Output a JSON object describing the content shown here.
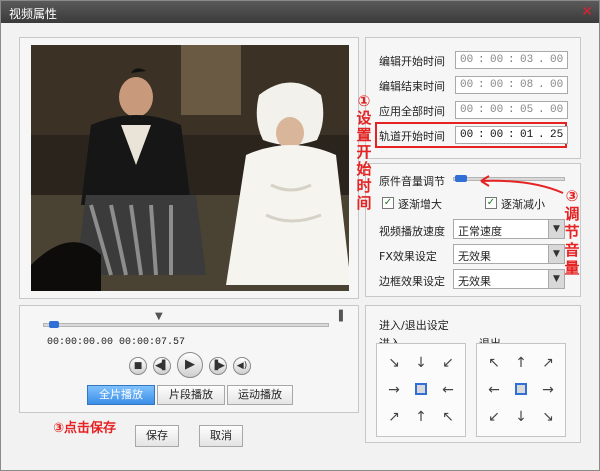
{
  "window": {
    "title": "视频属性",
    "close_glyph": "✕"
  },
  "time_fields": [
    {
      "label": "编辑开始时间",
      "h": "00",
      "m": "00",
      "s": "03",
      "f": "00"
    },
    {
      "label": "编辑结束时间",
      "h": "00",
      "m": "00",
      "s": "08",
      "f": "00"
    },
    {
      "label": "应用全部时间",
      "h": "00",
      "m": "00",
      "s": "05",
      "f": "00"
    },
    {
      "label": "轨道开始时间",
      "h": "00",
      "m": "00",
      "s": "01",
      "f": "25"
    }
  ],
  "volume": {
    "label": "原件音量调节",
    "fade_in": "逐渐增大",
    "fade_out": "逐渐减小"
  },
  "settings": [
    {
      "label": "视频播放速度",
      "value": "正常速度"
    },
    {
      "label": "FX效果设定",
      "value": "无效果"
    },
    {
      "label": "边框效果设定",
      "value": "无效果"
    }
  ],
  "playback": {
    "current_time": "00:00:00.00",
    "total_time": "00:00:07.57",
    "progress": 0.02,
    "modes": [
      "全片播放",
      "片段播放",
      "运动播放"
    ],
    "selected_mode": 0
  },
  "transition": {
    "title": "进入/退出设定",
    "enter_label": "进入",
    "exit_label": "退出"
  },
  "actions": {
    "save": "保存",
    "cancel": "取消"
  },
  "annotations": {
    "one": "①设置开始时间",
    "three_volume": "③调节音量",
    "three_save": "③点击保存"
  },
  "colors": {
    "accent": "#2f6fd6",
    "annotation": "#e52323"
  }
}
